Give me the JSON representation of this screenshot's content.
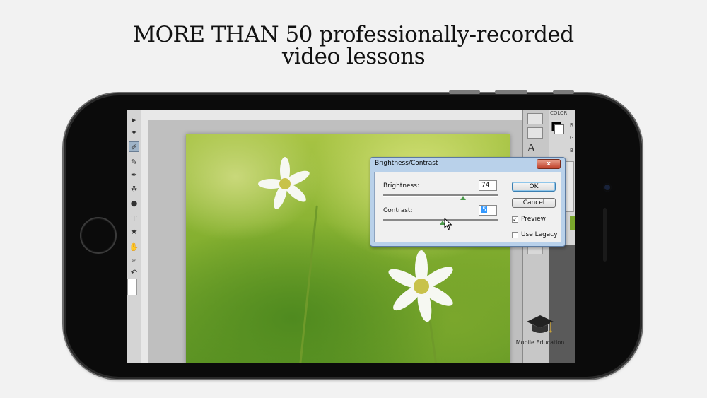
{
  "headline": {
    "line1": "MORE THAN 50 professionally-recorded",
    "line2": "video lessons"
  },
  "photoshop": {
    "color_panel": {
      "label": "COLOR",
      "channels": [
        "R",
        "G",
        "B"
      ]
    },
    "type_tool_glyph": "A",
    "tools": [
      "▸",
      "✦",
      "✐",
      "✎",
      "✒",
      "☘",
      "●",
      "T",
      "★",
      "✋",
      "⌕",
      "↶"
    ]
  },
  "dialog": {
    "title": "Brightness/Contrast",
    "close_glyph": "x",
    "brightness_label": "Brightness:",
    "brightness_value": "74",
    "brightness_level": 0.7,
    "contrast_label": "Contrast:",
    "contrast_value": "5",
    "contrast_level": 0.52,
    "ok_label": "OK",
    "cancel_label": "Cancel",
    "preview_label": "Preview",
    "preview_checked": true,
    "legacy_label": "Use Legacy",
    "legacy_checked": false
  },
  "logo": {
    "text": "Mobile Education"
  },
  "colors": {
    "phone_body": "#0b0b0b",
    "dialog_frame": "#b9d1ea",
    "close_button": "#c0402a"
  }
}
